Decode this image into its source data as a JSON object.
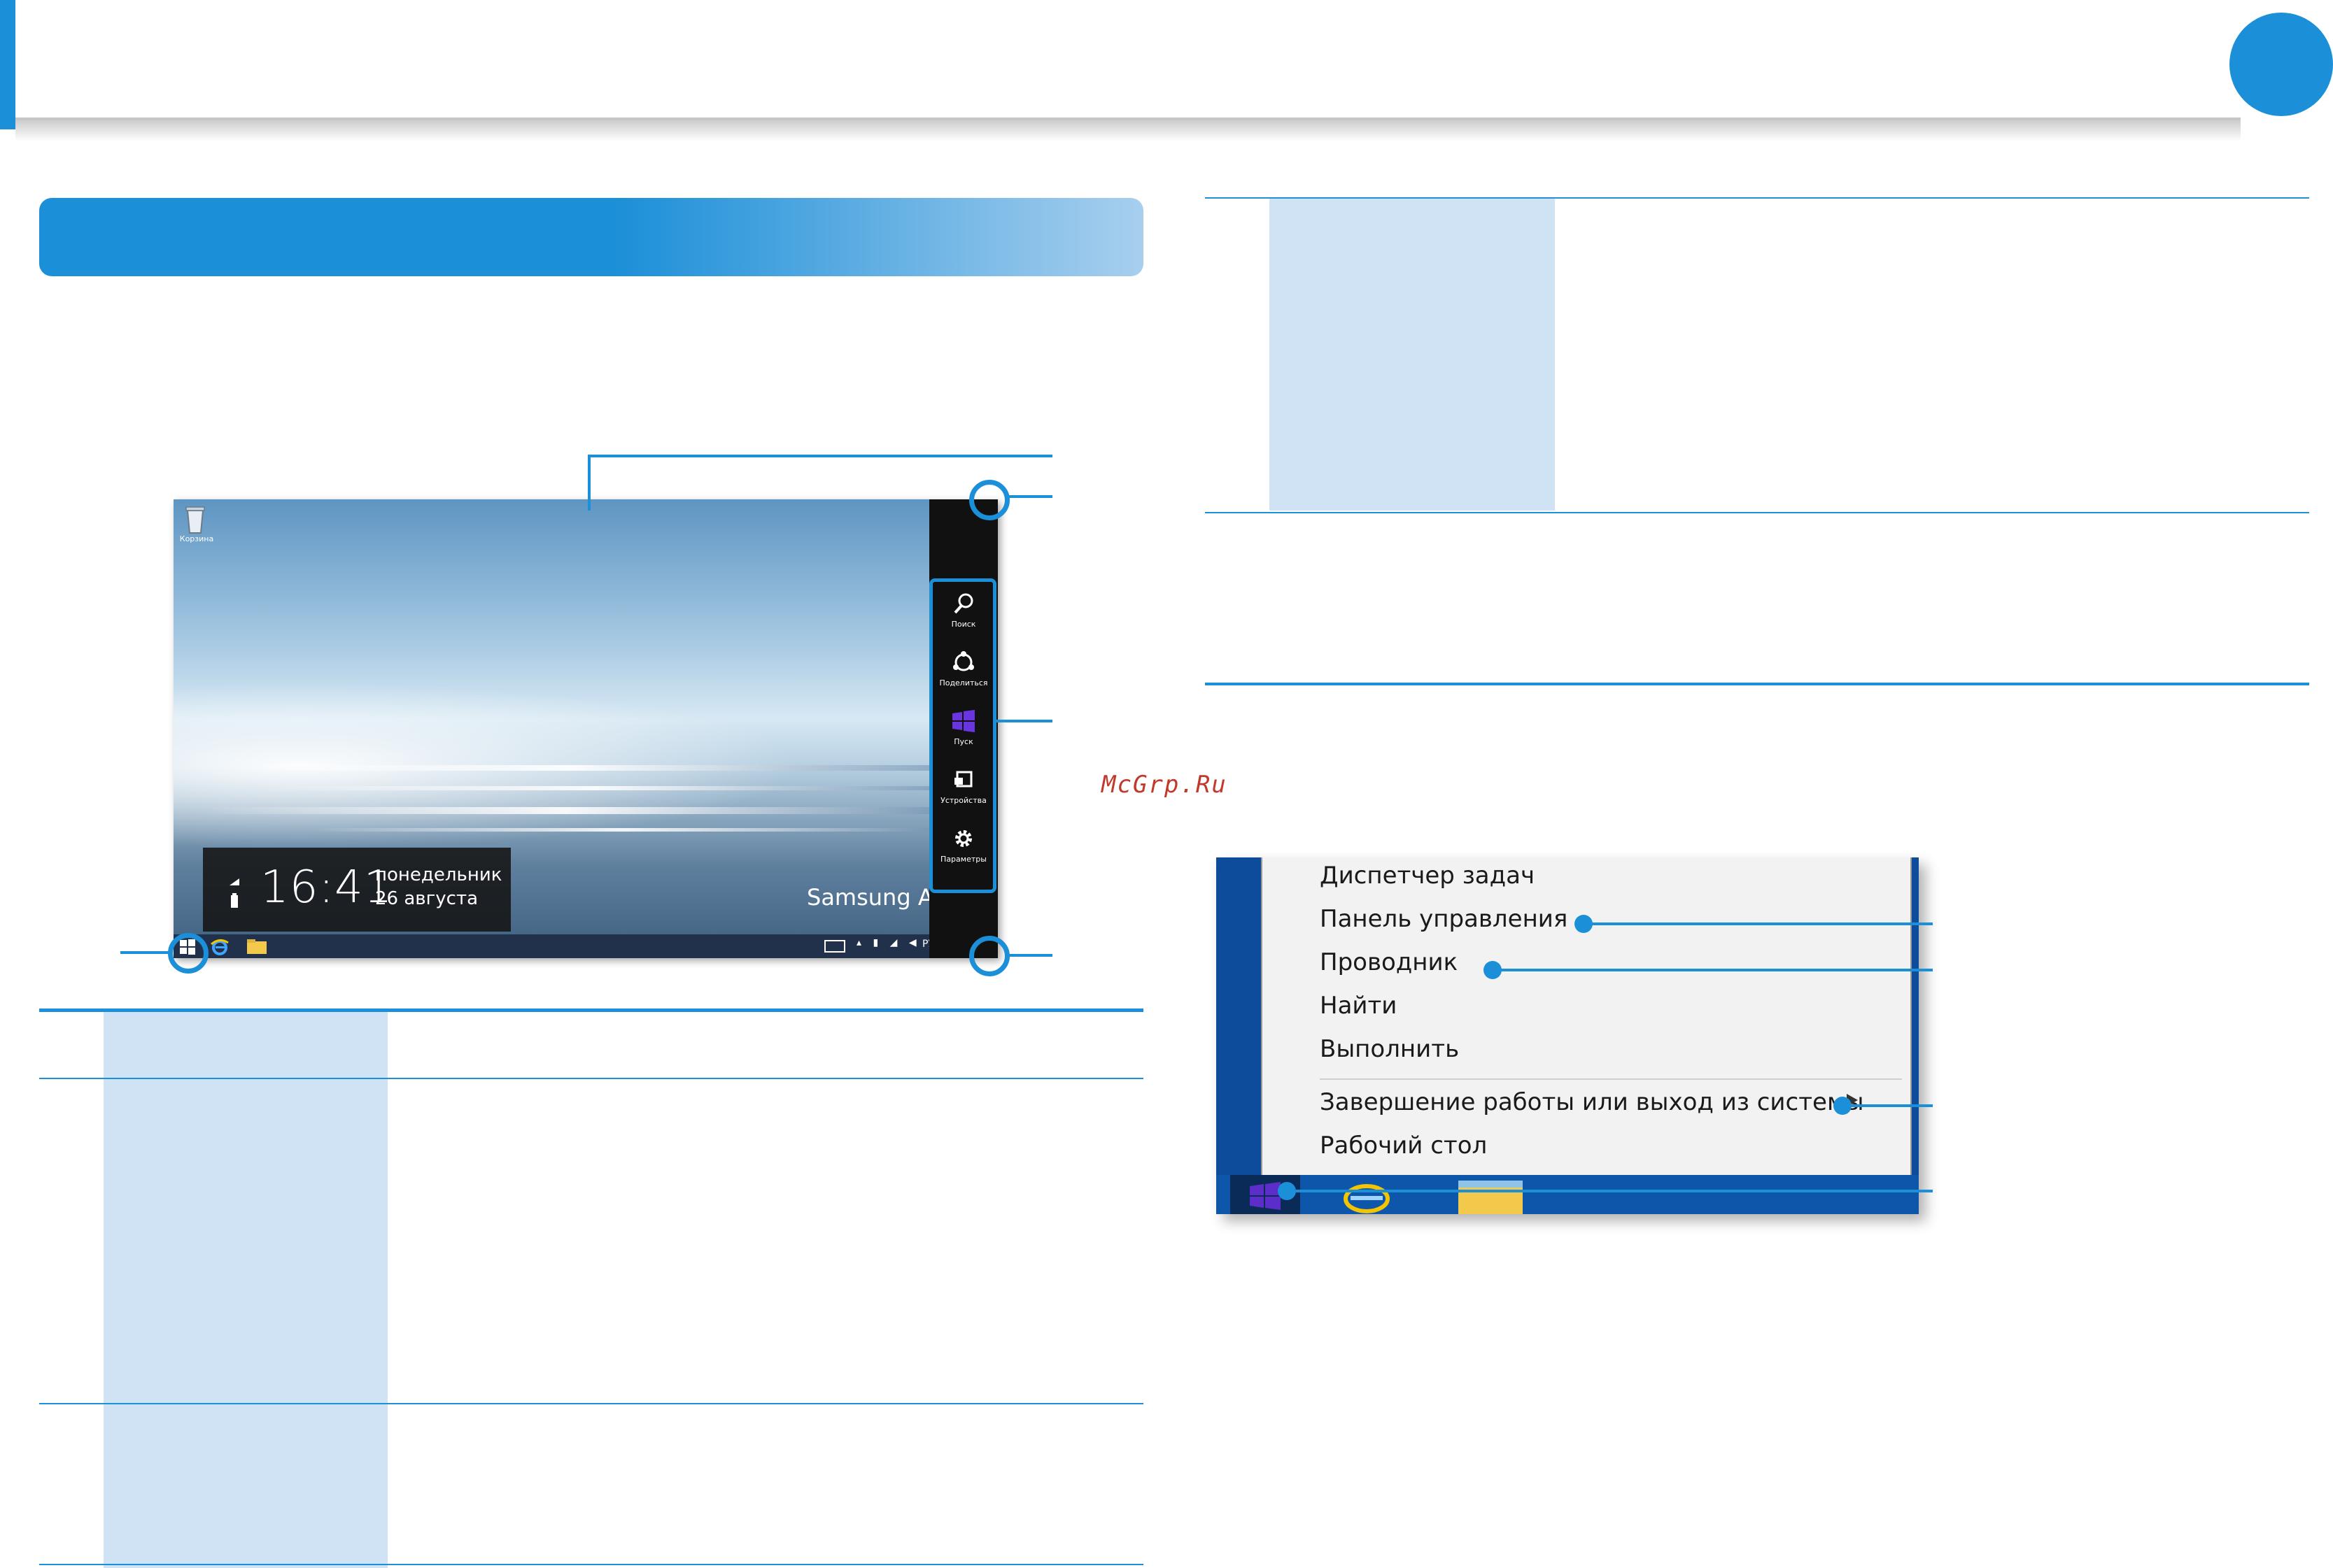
{
  "desktop": {
    "recycle_label": "Корзина",
    "clock_time": "16:41",
    "clock_day": "понедельник",
    "clock_date": "26 августа",
    "brand": "Samsung ATI",
    "tray": "РУ",
    "charms": [
      {
        "label": "Поиск",
        "icon": "search-icon"
      },
      {
        "label": "Поделиться",
        "icon": "share-icon"
      },
      {
        "label": "Пуск",
        "icon": "windows-logo-icon"
      },
      {
        "label": "Устройства",
        "icon": "devices-icon"
      },
      {
        "label": "Параметры",
        "icon": "gear-icon"
      }
    ]
  },
  "context_menu": {
    "items": [
      "Диспетчер задач",
      "Панель управления",
      "Проводник",
      "Найти",
      "Выполнить",
      "Завершение работы или выход из системы",
      "Рабочий стол"
    ]
  },
  "watermark": "McGrp.Ru",
  "colors": {
    "accent": "#1b8fd8",
    "table_cell": "#cfe3f5",
    "charms_bar": "#111111",
    "start_purple": "#5b2ec9"
  }
}
